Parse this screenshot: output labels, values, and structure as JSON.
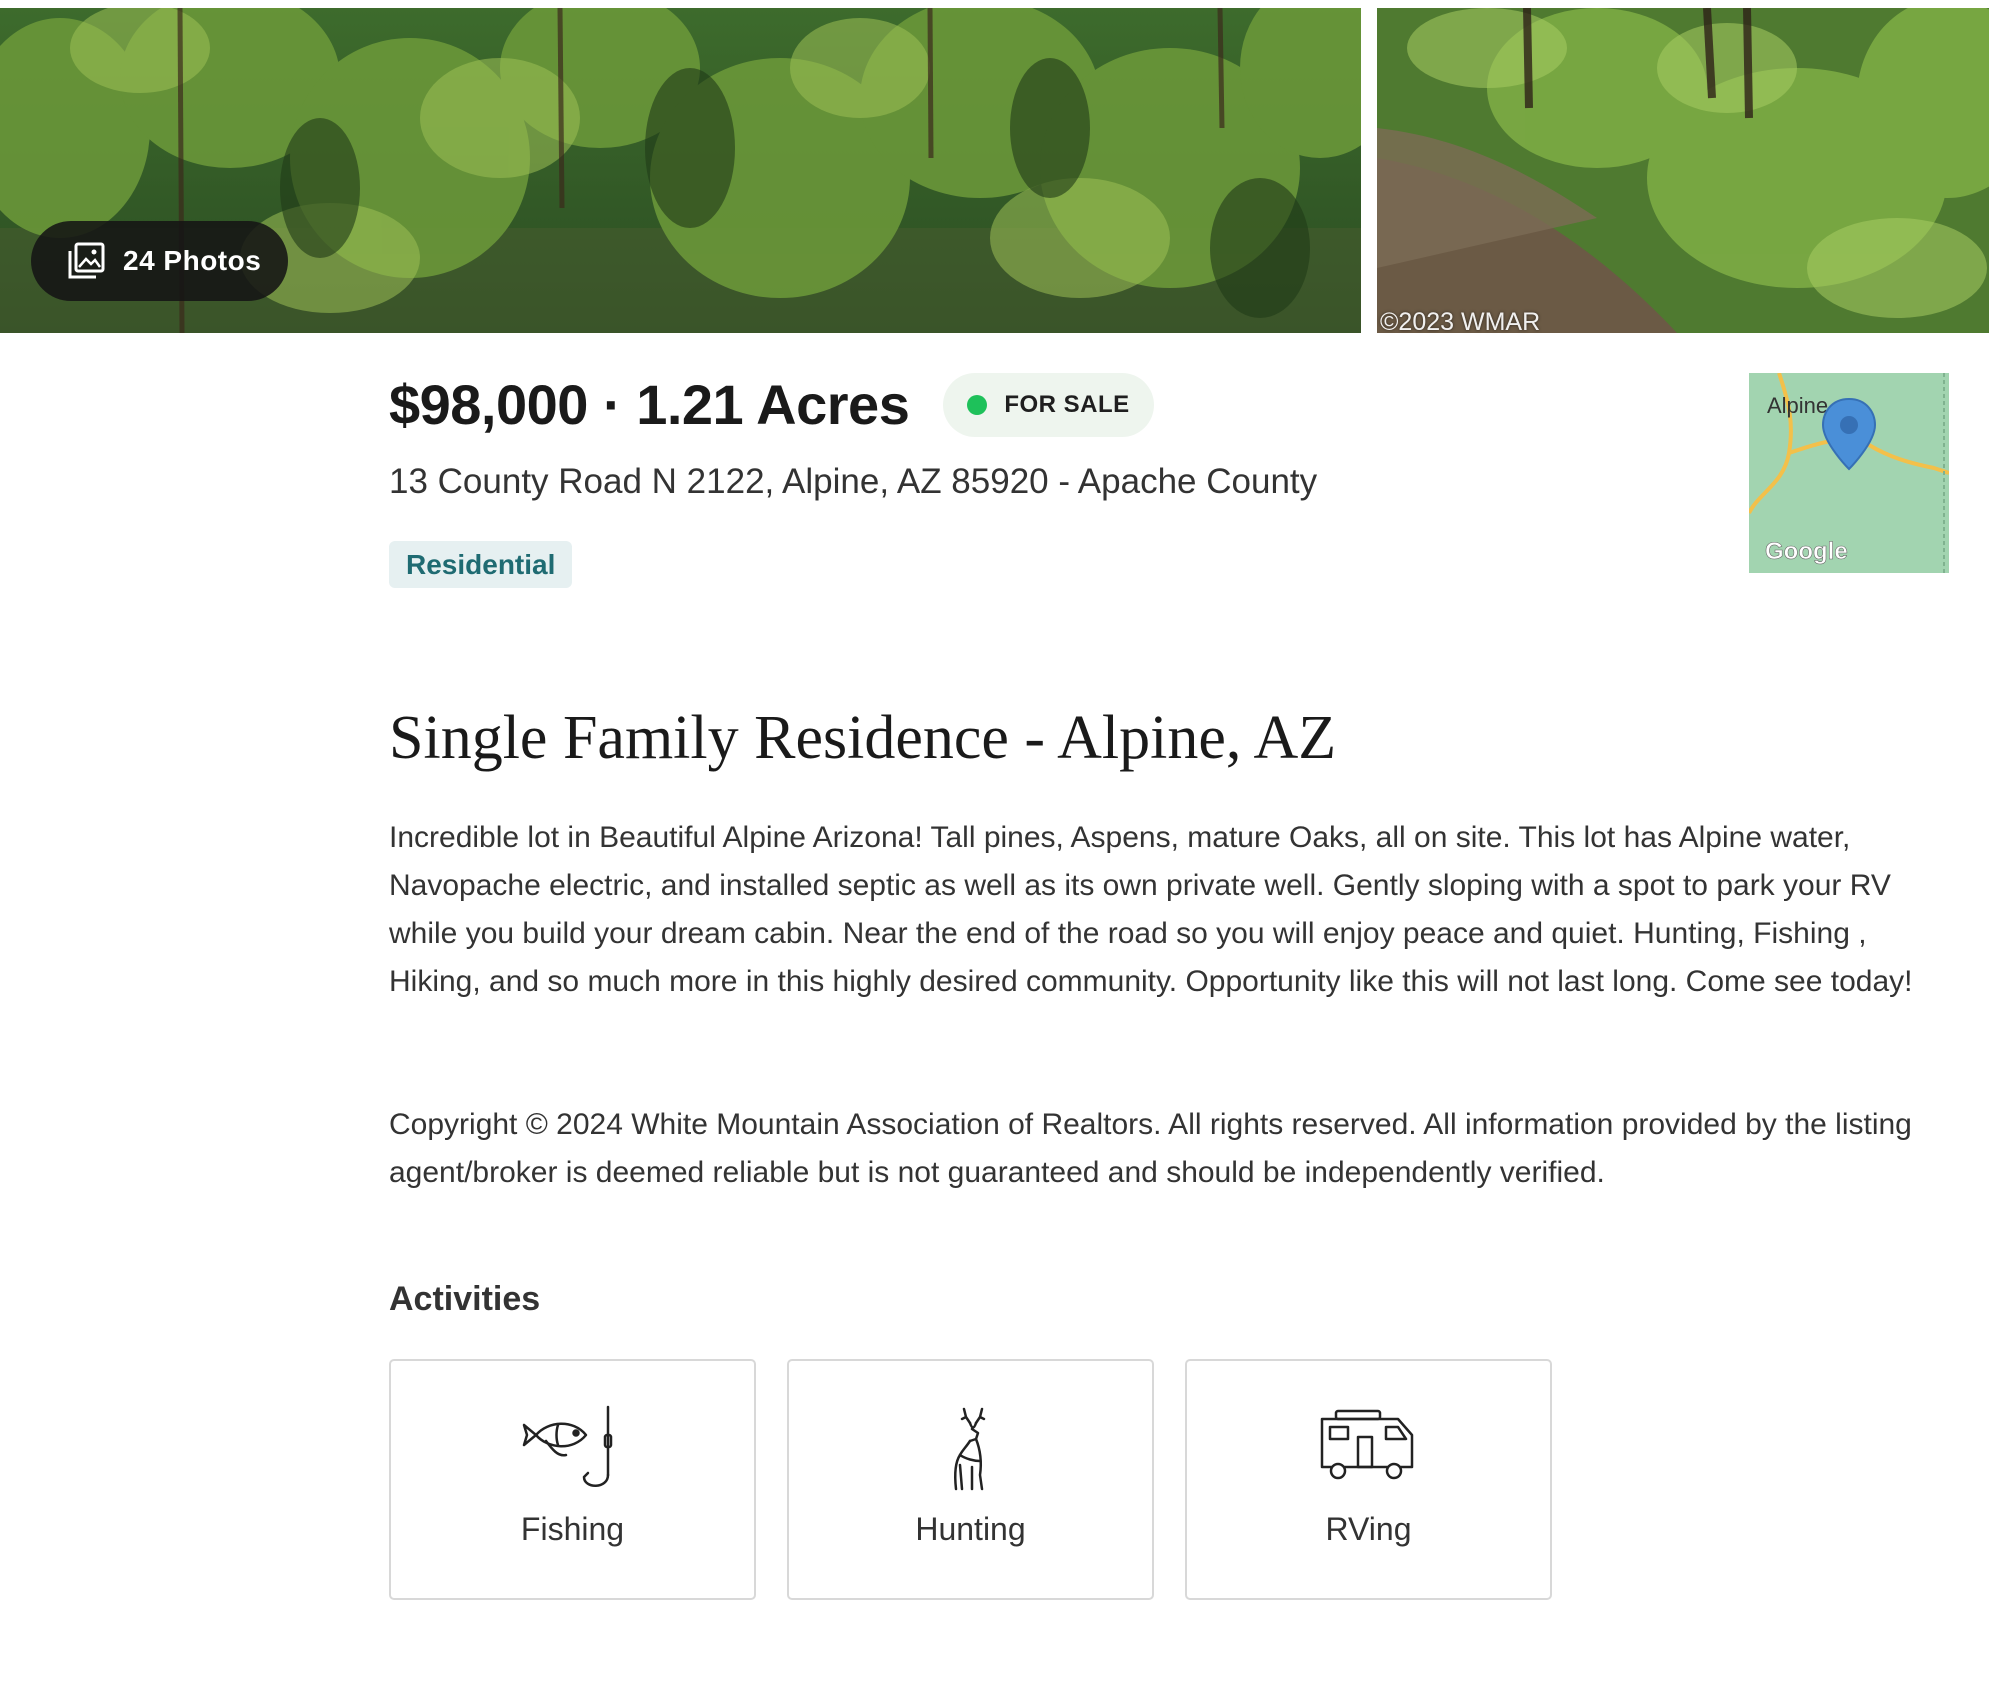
{
  "gallery": {
    "photos_button_label": "24 Photos",
    "photo_credit": "©2023  WMAR"
  },
  "listing": {
    "title": "$98,000 · 1.21 Acres",
    "status": "FOR SALE",
    "status_color": "#1ec15a",
    "address": "13 County Road N 2122, Alpine, AZ 85920 - Apache County",
    "property_type": "Residential"
  },
  "map": {
    "place_label": "Alpine",
    "provider": "Google"
  },
  "description": {
    "heading": "Single Family Residence - Alpine, AZ",
    "body": "Incredible lot in Beautiful Alpine Arizona! Tall pines, Aspens, mature Oaks, all on site. This lot has Alpine water, Navopache electric, and installed septic as well as its own private well. Gently sloping with a spot to park your RV while you build your dream cabin. Near the end of the road so you will enjoy peace and quiet. Hunting, Fishing , Hiking, and so much more in this highly desired community. Opportunity like this will not last long. Come see today!",
    "copyright": "Copyright © 2024 White Mountain Association of Realtors. All rights reserved. All information provided by the listing agent/broker is deemed reliable but is not guaranteed and should be independently verified."
  },
  "activities": {
    "title": "Activities",
    "items": [
      {
        "label": "Fishing",
        "icon": "fish-hook-icon"
      },
      {
        "label": "Hunting",
        "icon": "deer-icon"
      },
      {
        "label": "RVing",
        "icon": "rv-icon"
      }
    ]
  }
}
